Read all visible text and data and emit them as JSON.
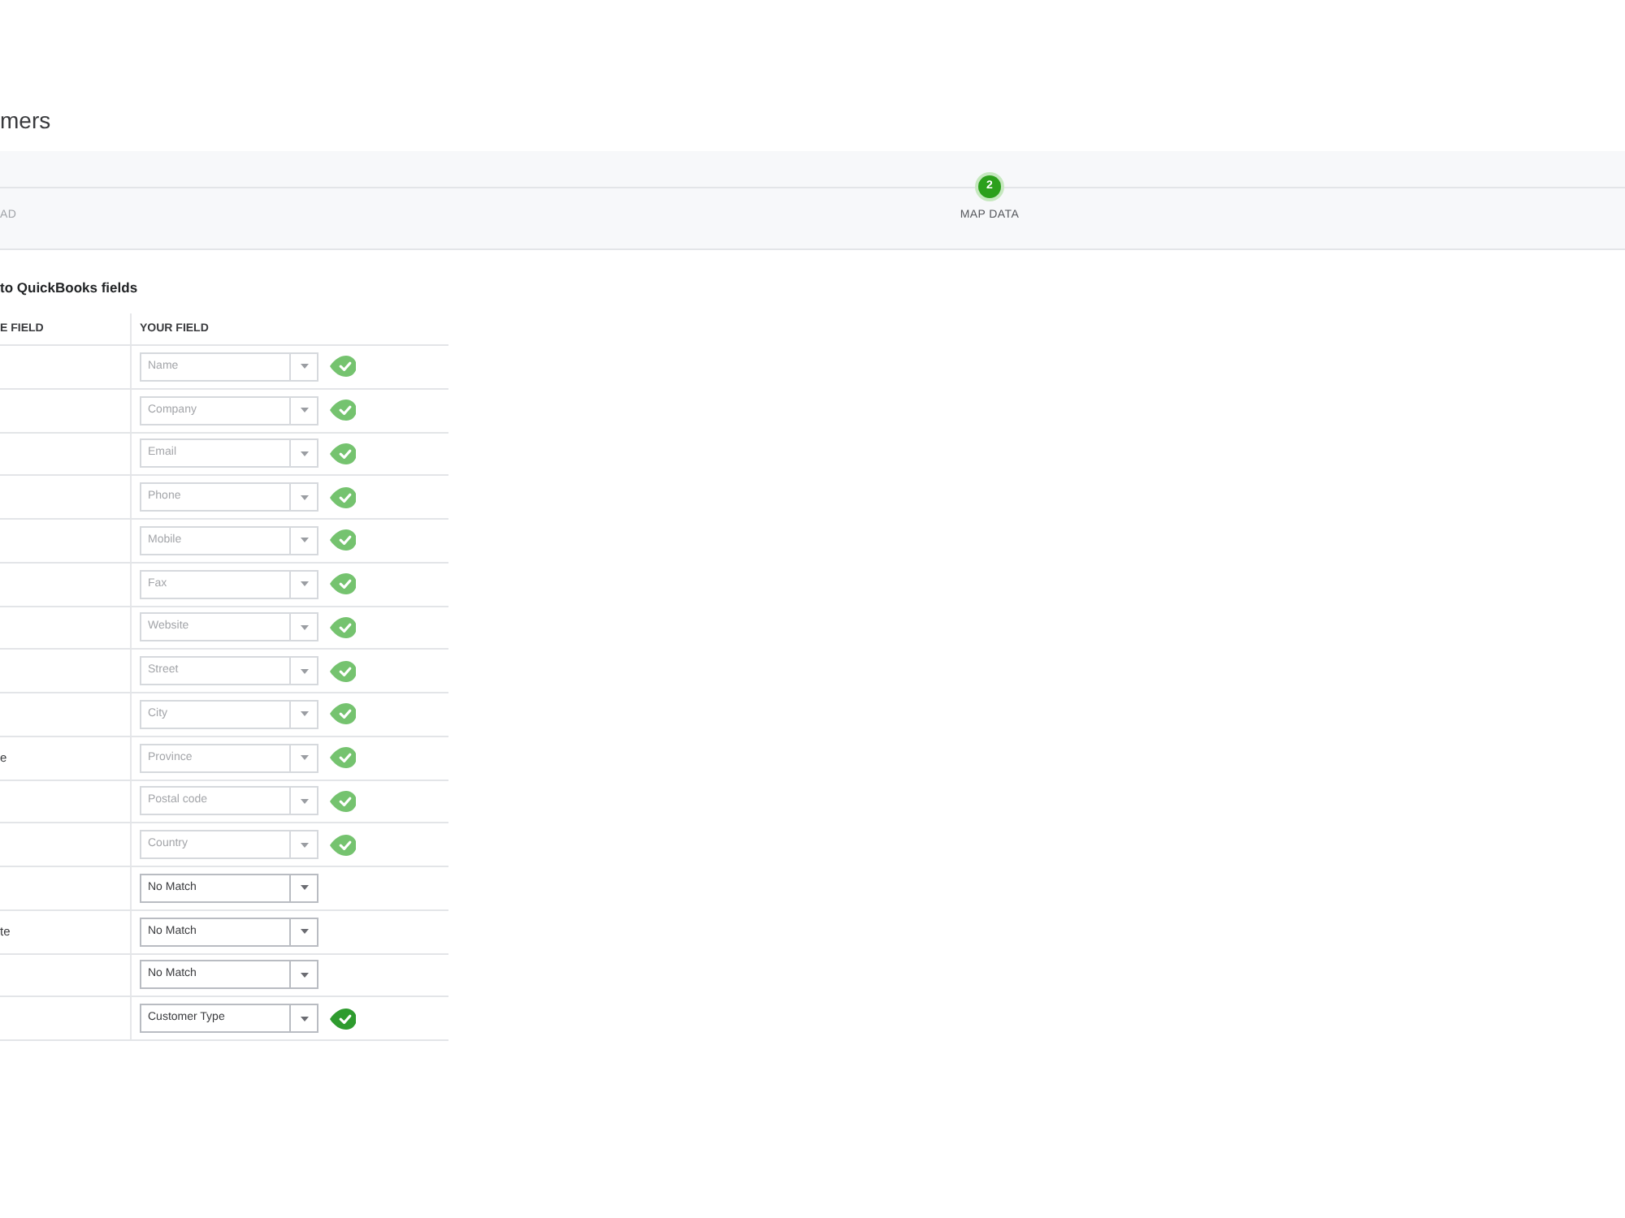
{
  "page": {
    "title": "mers"
  },
  "stepper": {
    "steps": [
      {
        "label": "AD",
        "selected": false
      },
      {
        "number": "2",
        "label": "MAP DATA",
        "selected": true
      }
    ]
  },
  "mapping": {
    "heading": "to QuickBooks fields",
    "columns": [
      "E FIELD",
      "YOUR FIELD"
    ],
    "rows": [
      {
        "value": "Name",
        "matched": true,
        "disabled": true
      },
      {
        "value": "Company",
        "matched": true,
        "disabled": true
      },
      {
        "value": "Email",
        "matched": true,
        "disabled": true
      },
      {
        "value": "Phone",
        "matched": true,
        "disabled": true
      },
      {
        "value": "Mobile",
        "matched": true,
        "disabled": true
      },
      {
        "value": "Fax",
        "matched": true,
        "disabled": true
      },
      {
        "value": "Website",
        "matched": true,
        "disabled": true
      },
      {
        "value": "Street",
        "matched": true,
        "disabled": true
      },
      {
        "value": "City",
        "matched": true,
        "disabled": true
      },
      {
        "label": "e",
        "value": "Province",
        "matched": true,
        "disabled": true
      },
      {
        "value": "Postal code",
        "matched": true,
        "disabled": true
      },
      {
        "value": "Country",
        "matched": true,
        "disabled": true
      },
      {
        "value": "No Match",
        "matched": false,
        "disabled": false
      },
      {
        "label": "te",
        "value": "No Match",
        "matched": false,
        "disabled": false
      },
      {
        "value": "No Match",
        "matched": false,
        "disabled": false
      },
      {
        "value": "Customer Type",
        "matched": true,
        "disabled": false
      }
    ]
  }
}
